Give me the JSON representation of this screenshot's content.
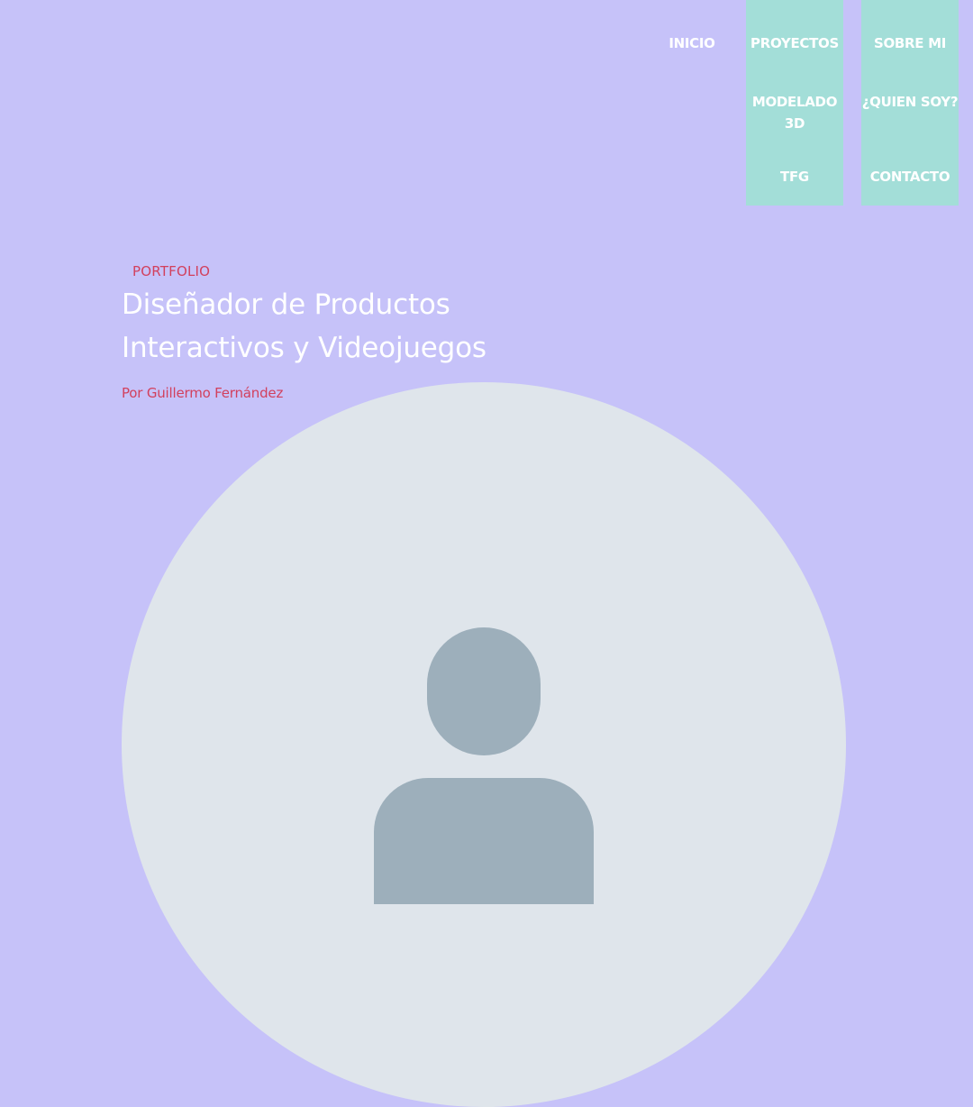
{
  "nav": {
    "inicio": "INICIO",
    "proyectos": {
      "label": "PROYECTOS",
      "items": [
        "MODELADO 3D",
        "TFG"
      ]
    },
    "sobre_mi": {
      "label": "SOBRE MI",
      "items": [
        "¿QUIEN SOY?",
        "CONTACTO"
      ]
    }
  },
  "hero": {
    "kicker": "PORTFOLIO",
    "title_line1": "Diseñador de Productos",
    "title_line2": "Interactivos y Videojuegos",
    "byline": "Por Guillermo Fernández"
  },
  "avatar": {
    "icon": "user-avatar-placeholder-icon",
    "colors": {
      "circle": "#dfe5eb",
      "figure": "#9dafbb"
    }
  },
  "colors": {
    "background": "#c6c2f9",
    "nav_dropdown": "#a3ded8",
    "accent": "#d2405d",
    "text_light": "#ffffff"
  }
}
